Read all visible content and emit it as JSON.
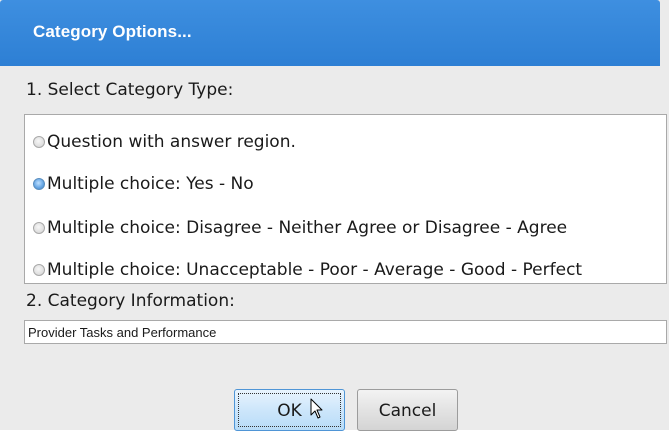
{
  "dialog": {
    "title": "Category Options..."
  },
  "section1": {
    "label": "1. Select Category Type:",
    "options": [
      {
        "label": "Question with answer region.",
        "checked": false
      },
      {
        "label": "Multiple choice: Yes - No",
        "checked": true
      },
      {
        "label": "Multiple choice: Disagree - Neither Agree or Disagree - Agree",
        "checked": false
      },
      {
        "label": "Multiple choice: Unacceptable - Poor - Average - Good - Perfect",
        "checked": false
      }
    ]
  },
  "section2": {
    "label": "2. Category Information:",
    "value": "Provider Tasks and Performance"
  },
  "buttons": {
    "ok_label": "OK",
    "cancel_label": "Cancel"
  },
  "icons": {
    "cursor": "arrow-cursor-icon",
    "radio_unchecked": "radio-unchecked-icon",
    "radio_checked": "radio-checked-icon"
  },
  "colors": {
    "title_bar": "#2d7fd4",
    "dialog_background": "#ebebeb",
    "ok_border": "#4f95d6"
  }
}
